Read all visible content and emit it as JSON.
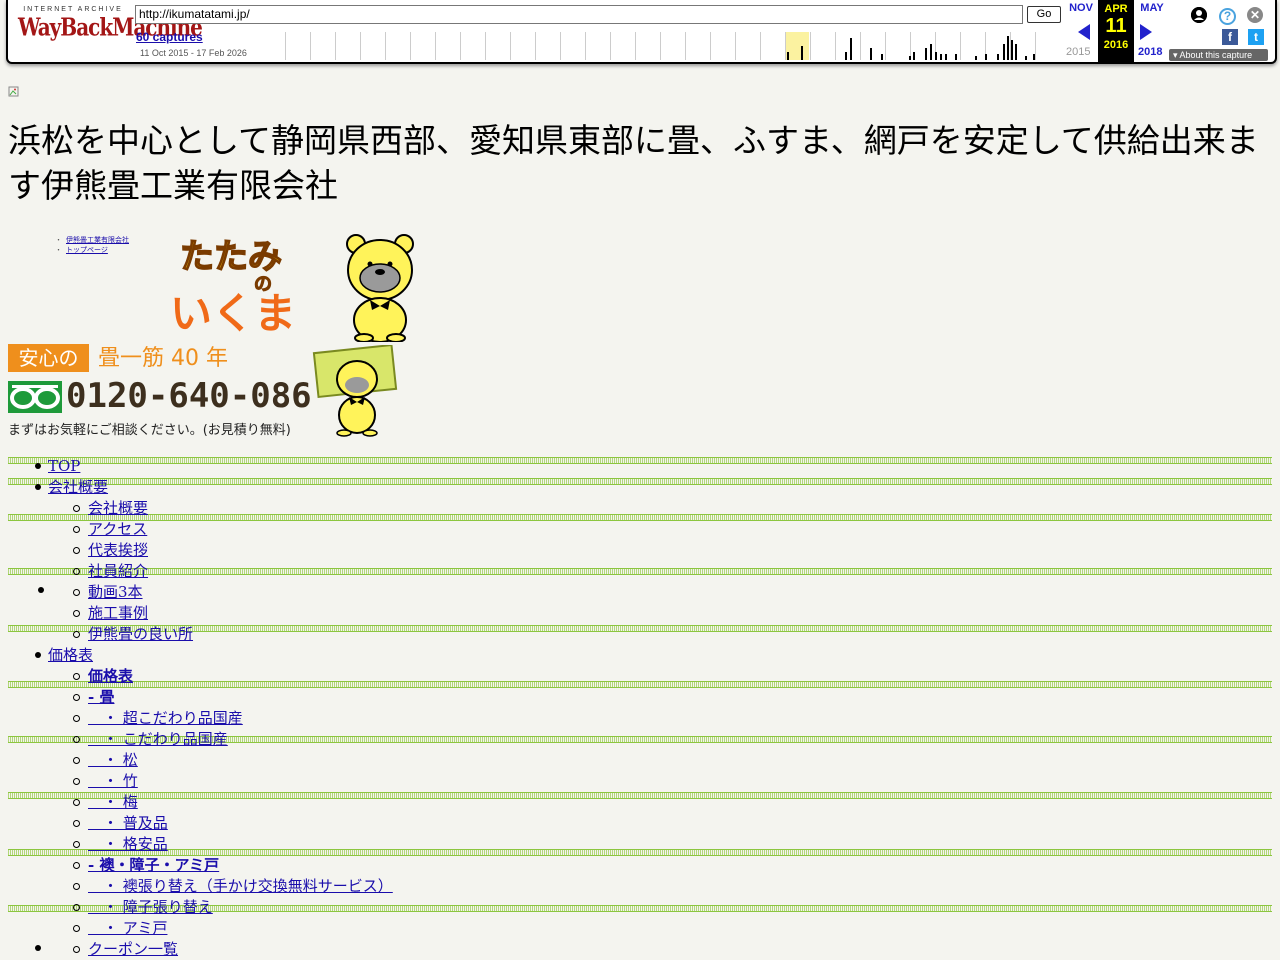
{
  "wayback": {
    "logo_top": "INTERNET ARCHIVE",
    "logo_main": "WayBackMachine",
    "url": "http://ikumatatami.jp/",
    "go_label": "Go",
    "captures_label": "60 captures",
    "date_range": "11 Oct 2015 - 17 Feb 2026",
    "prev_month": "NOV",
    "current_month": "APR",
    "current_day": "11",
    "current_year": "2016",
    "next_month": "MAY",
    "prev_year": "2015",
    "next_year": "2018",
    "about_label": "About this capture",
    "user_icon": "user-icon",
    "help_icon": "help-icon",
    "close_icon": "close-icon",
    "facebook_icon": "f",
    "twitter_icon": "t"
  },
  "page": {
    "title": "浜松を中心として静岡県西部、愛知県東部に畳、ふすま、網戸を安定して供給出来ます伊熊畳工業有限会社",
    "mini_nav": [
      "伊熊畳工業有限会社",
      "トップページ"
    ],
    "logo_text_top": "たたみ",
    "logo_text_mid": "の",
    "logo_text_bottom": "いくま",
    "slogan_box": "安心の",
    "slogan_rest": "畳一筋 40 年",
    "phone": "0120-640-086",
    "consult": "まずはお気軽にご相談ください。(お見積り無料)"
  },
  "menu": [
    {
      "label": "TOP",
      "level": 1,
      "bold": false
    },
    {
      "label": "会社概要",
      "level": 1,
      "bold": false
    },
    {
      "label": "会社概要",
      "level": 2,
      "bold": false
    },
    {
      "label": "アクセス",
      "level": 2,
      "bold": false
    },
    {
      "label": "代表挨拶",
      "level": 2,
      "bold": false
    },
    {
      "label": "社員紹介",
      "level": 2,
      "bold": false
    },
    {
      "label": "動画3本",
      "level": 2,
      "bold": false
    },
    {
      "label": "施工事例",
      "level": 2,
      "bold": false
    },
    {
      "label": "伊熊畳の良い所",
      "level": 2,
      "bold": false
    },
    {
      "label": "価格表",
      "level": 1,
      "bold": false
    },
    {
      "label": "価格表",
      "level": 2,
      "bold": true
    },
    {
      "label": "- 畳",
      "level": 2,
      "bold": true
    },
    {
      "label": "　・ 超こだわり品国産",
      "level": 2,
      "bold": false
    },
    {
      "label": "　・ こだわり品国産",
      "level": 2,
      "bold": false
    },
    {
      "label": "　・ 松",
      "level": 2,
      "bold": false
    },
    {
      "label": "　・ 竹",
      "level": 2,
      "bold": false
    },
    {
      "label": "　・ 梅",
      "level": 2,
      "bold": false
    },
    {
      "label": "　・ 普及品",
      "level": 2,
      "bold": false
    },
    {
      "label": "　・ 格安品",
      "level": 2,
      "bold": false
    },
    {
      "label": "- 襖・障子・アミ戸",
      "level": 2,
      "bold": true
    },
    {
      "label": "　・ 襖張り替え（手かけ交換無料サービス）",
      "level": 2,
      "bold": false
    },
    {
      "label": "　・ 障子張り替え",
      "level": 2,
      "bold": false
    },
    {
      "label": "　・ アミ戸",
      "level": 2,
      "bold": false
    },
    {
      "label": "クーポン一覧",
      "level": 2,
      "bold": false
    }
  ],
  "colors": {
    "accent_orange": "#ef8f1c",
    "green_line": "#8cc63f",
    "link": "#1a0dab",
    "wayback_red": "#a31616"
  }
}
